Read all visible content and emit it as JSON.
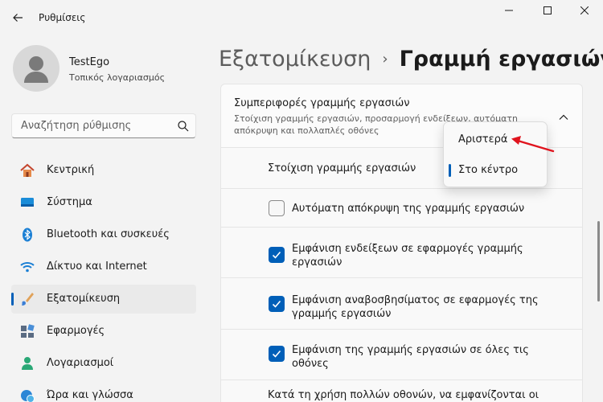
{
  "window": {
    "title": "Ρυθμίσεις"
  },
  "profile": {
    "name": "TestEgo",
    "account_type": "Τοπικός λογαριασμός"
  },
  "search": {
    "placeholder": "Αναζήτηση ρύθμισης"
  },
  "nav": {
    "items": [
      {
        "label": "Κεντρική",
        "icon": "home-icon"
      },
      {
        "label": "Σύστημα",
        "icon": "monitor-icon"
      },
      {
        "label": "Bluetooth και συσκευές",
        "icon": "bluetooth-icon"
      },
      {
        "label": "Δίκτυο και Internet",
        "icon": "wifi-icon"
      },
      {
        "label": "Εξατομίκευση",
        "icon": "brush-icon",
        "selected": true
      },
      {
        "label": "Εφαρμογές",
        "icon": "apps-icon"
      },
      {
        "label": "Λογαριασμοί",
        "icon": "person-icon"
      },
      {
        "label": "Ώρα και γλώσσα",
        "icon": "globe-clock-icon"
      }
    ]
  },
  "breadcrumb": {
    "parent": "Εξατομίκευση",
    "separator": "›",
    "current": "Γραμμή εργασιών"
  },
  "section": {
    "title": "Συμπεριφορές γραμμής εργασιών",
    "description": "Στοίχιση γραμμής εργασιών, προσαρμογή ενδείξεων, αυτόματη απόκρυψη και πολλαπλές οθόνες",
    "alignment_label": "Στοίχιση γραμμής εργασιών",
    "checkboxes": [
      {
        "label": "Αυτόματη απόκρυψη της γραμμής εργασιών",
        "checked": false
      },
      {
        "label": "Εμφάνιση ενδείξεων σε εφαρμογές γραμμής εργασιών",
        "checked": true
      },
      {
        "label": "Εμφάνιση αναβοσβησίματος σε εφαρμογές της γραμμής εργασιών",
        "checked": true
      },
      {
        "label": "Εμφάνιση της γραμμής εργασιών σε όλες τις οθόνες",
        "checked": true
      }
    ],
    "multi_monitor_label": "Κατά τη χρήση πολλών οθονών, να εμφανίζονται οι"
  },
  "dropdown": {
    "options": [
      "Αριστερά",
      "Στο κέντρο"
    ],
    "selected": "Στο κέντρο"
  },
  "colors": {
    "accent": "#005fb8",
    "annotation_arrow": "#e0141e"
  }
}
